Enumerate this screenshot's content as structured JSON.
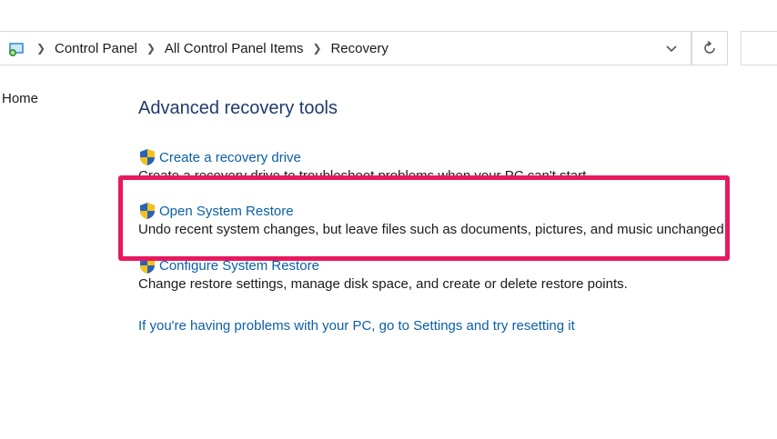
{
  "addressbar": {
    "icon": "control-panel-icon",
    "breadcrumbs": [
      "Control Panel",
      "All Control Panel Items",
      "Recovery"
    ],
    "dropdown_icon": "chevron-down-icon",
    "refresh_icon": "refresh-icon"
  },
  "sidebar": {
    "home_label": "Home"
  },
  "main": {
    "title": "Advanced recovery tools",
    "items": [
      {
        "label": "Create a recovery drive",
        "description": "Create a recovery drive to troubleshoot problems when your PC can't start.",
        "icon": "uac-shield-icon"
      },
      {
        "label": "Open System Restore",
        "description": "Undo recent system changes, but leave files such as documents, pictures, and music unchanged.",
        "icon": "uac-shield-icon"
      },
      {
        "label": "Configure System Restore",
        "description": "Change restore settings, manage disk space, and create or delete restore points.",
        "icon": "uac-shield-icon"
      }
    ],
    "reset_link": "If you're having problems with your PC, go to Settings and try resetting it"
  },
  "annotation": {
    "highlight_color": "#e8195e"
  }
}
